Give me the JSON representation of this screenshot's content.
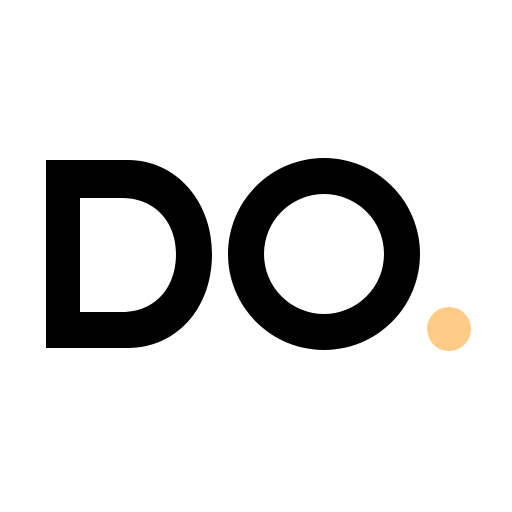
{
  "logo": {
    "wordmark": "DO.",
    "letter_color": "#000000",
    "dot_color": "#FFCC88",
    "background_color": "#FFFFFF"
  }
}
